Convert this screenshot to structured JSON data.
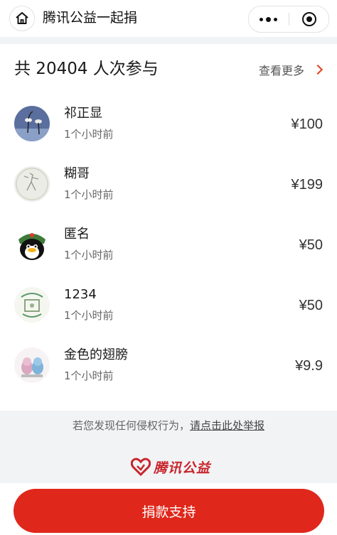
{
  "nav": {
    "title": "腾讯公益一起捐"
  },
  "summary": {
    "total_text": "共 20404 人次参与",
    "see_more": "查看更多"
  },
  "donors": [
    {
      "name": "祁正显",
      "time": "1个小时前",
      "amount": "¥100"
    },
    {
      "name": "糊哥",
      "time": "1个小时前",
      "amount": "¥199"
    },
    {
      "name": "匿名",
      "time": "1个小时前",
      "amount": "¥50"
    },
    {
      "name": "1234",
      "time": "1个小时前",
      "amount": "¥50"
    },
    {
      "name": "金色的翅膀",
      "time": "1个小时前",
      "amount": "¥9.9"
    }
  ],
  "footer": {
    "report_prefix": "若您发现任何侵权行为，",
    "report_link": "请点击此处举报",
    "brand": "腾讯公益"
  },
  "cta": {
    "donate_label": "捐款支持"
  },
  "colors": {
    "accent": "#e0271b",
    "brand_red": "#c8252c"
  }
}
